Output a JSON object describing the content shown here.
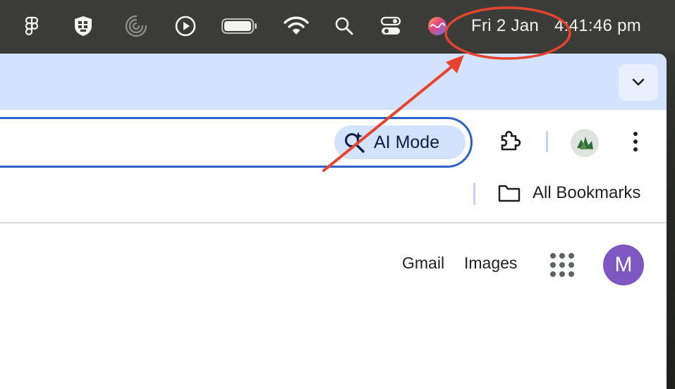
{
  "menubar": {
    "date": "Fri 2 Jan",
    "time": "4:41:46 pm",
    "icons": [
      "figma-icon",
      "shield-grid-icon",
      "activity-ring-icon",
      "play-circle-icon",
      "battery-icon",
      "wifi-icon",
      "spotlight-search-icon",
      "control-center-icon",
      "siri-icon"
    ]
  },
  "browser": {
    "tabstrip": {
      "dropdown_icon": "chevron-down-icon"
    },
    "toolbar": {
      "ai_mode_label": "AI Mode",
      "extensions_icon": "puzzle-icon",
      "menu_icon": "more-vert-icon"
    },
    "bookmarks": {
      "all_bookmarks_label": "All Bookmarks"
    },
    "page": {
      "gmail_label": "Gmail",
      "images_label": "Images",
      "avatar_letter": "M"
    }
  },
  "colors": {
    "annotation_red": "#e8432e",
    "omnibox_border": "#2c62c9",
    "tabstrip_bg": "#d3e3fd",
    "avatar_bg": "#7e57c2"
  }
}
